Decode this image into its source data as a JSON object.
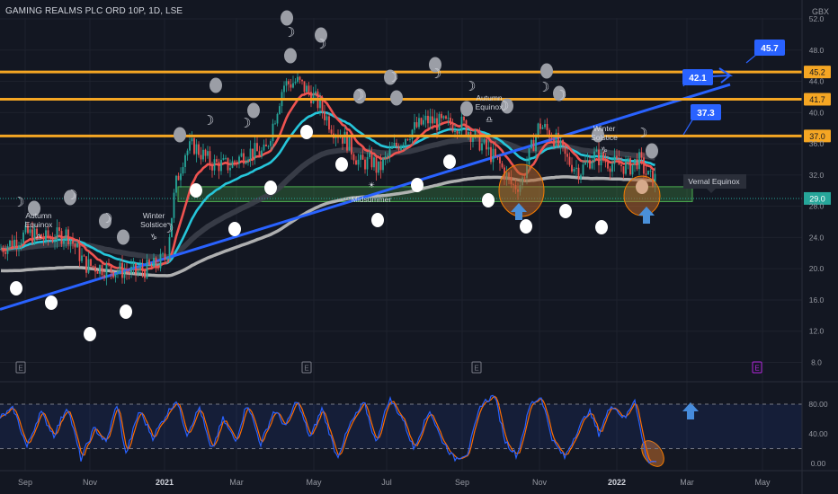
{
  "header": {
    "title": "GAMING REALMS PLC ORD 10P, 1D, LSE",
    "currency": "GBX"
  },
  "chart_data": {
    "type": "candlestick",
    "price_axis": {
      "ticks": [
        "8.0",
        "12.0",
        "16.0",
        "20.0",
        "24.0",
        "28.0",
        "32.0",
        "36.0",
        "40.0",
        "44.0",
        "48.0",
        "52.0"
      ],
      "ylim": [
        6,
        53
      ]
    },
    "time_axis": {
      "labels": [
        "Sep",
        "Nov",
        "2021",
        "Mar",
        "May",
        "Jul",
        "Sep",
        "Nov",
        "2022",
        "Mar",
        "May"
      ]
    },
    "horizontal_levels": [
      {
        "value": 45.2,
        "label": "45.2",
        "color": "#f5a623"
      },
      {
        "value": 41.7,
        "label": "41.7",
        "color": "#f5a623"
      },
      {
        "value": 37.0,
        "label": "37.0",
        "color": "#f5a623"
      }
    ],
    "last_price": {
      "value": 29.0,
      "label": "29.0",
      "color": "#26a69a"
    },
    "support_zone": {
      "top": 30.5,
      "bottom": 28.6,
      "color": "#4caf50"
    },
    "targets": [
      {
        "label": "37.3",
        "value": 37.3
      },
      {
        "label": "42.1",
        "value": 43.4
      },
      {
        "label": "45.7",
        "value": 47.6
      }
    ],
    "annotations": [
      {
        "text": "Autumn Equinox",
        "symbol": "♎"
      },
      {
        "text": "Winter Solstice",
        "symbol": "♑"
      },
      {
        "text": "Midsummer",
        "symbol": "☀"
      },
      {
        "text": "Autumn Equinox",
        "symbol": "♎"
      },
      {
        "text": "Winter Solstice",
        "symbol": "♑"
      },
      {
        "text": "Vernal Equinox"
      }
    ],
    "earnings_marker": "E",
    "series": [
      {
        "name": "",
        "color": "#ef5350"
      },
      {
        "name": "",
        "color": "#26c6da"
      },
      {
        "name": "",
        "color": "#3c3f4a"
      },
      {
        "name": "",
        "color": "#c0c0c0"
      },
      {
        "name": "",
        "color": "#2962ff"
      }
    ],
    "oscillator": {
      "ticks": [
        "0.00",
        "40.00",
        "80.00"
      ],
      "levels": [
        20,
        80
      ],
      "ylim": [
        -8,
        100
      ],
      "colors": {
        "k": "#2962ff",
        "d": "#ff6d00"
      }
    }
  }
}
